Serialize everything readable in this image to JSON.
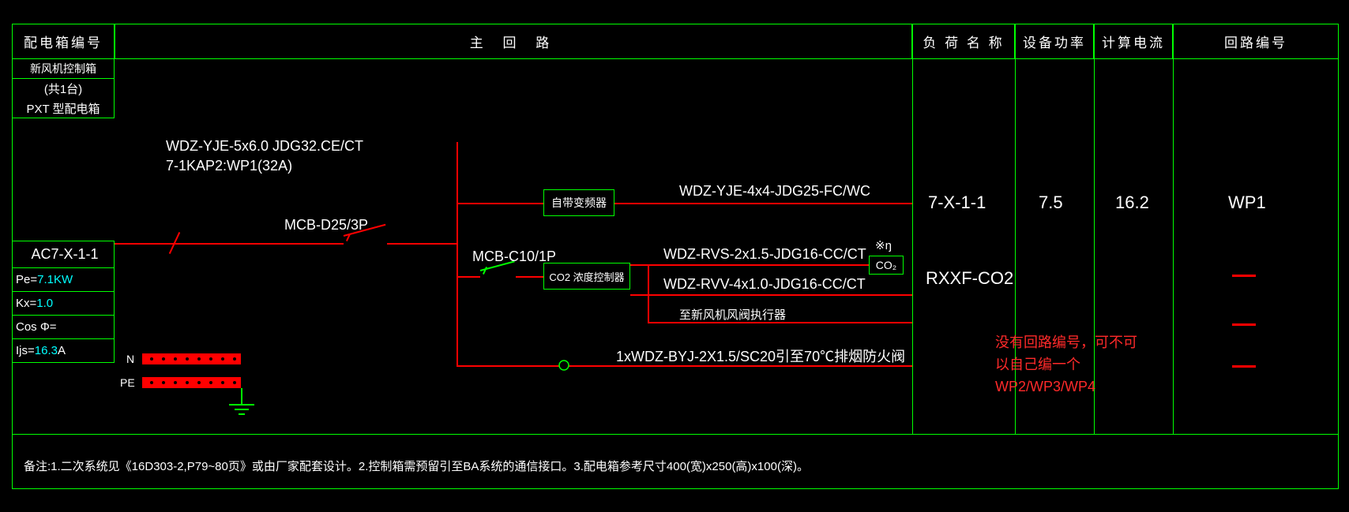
{
  "header": {
    "col1": "配电箱编号",
    "col_main": "主 回 路",
    "col_load": "负 荷 名 称",
    "col_power": "设备功率",
    "col_current": "计算电流",
    "col_loop": "回路编号"
  },
  "side": {
    "line1": "新风机控制箱",
    "line2": "(共1台)",
    "line3": "PXT 型配电箱",
    "panel_id": "AC7-X-1-1",
    "pe_label": "Pe=",
    "pe_val": "7.1KW",
    "kx_label": "Kx=",
    "kx_val": "1.0",
    "cos_label": "Cos Φ=",
    "ijs_label": "Ijs=",
    "ijs_val": "16.3",
    "ijs_unit": "A"
  },
  "busbars": {
    "n": "N",
    "pe": "PE"
  },
  "wires": {
    "incoming_top": "WDZ-YJE-5x6.0 JDG32.CE/CT",
    "incoming_bot": "7-1KAP2:WP1(32A)",
    "mcb_main": "MCB-D25/3P",
    "mcb_sub": "MCB-C10/1P",
    "inverter_box": "自带变频器",
    "co2_box": "CO2 浓度控制器",
    "cable1": "WDZ-YJE-4x4-JDG25-FC/WC",
    "cable2": "WDZ-RVS-2x1.5-JDG16-CC/CT",
    "cable3": "WDZ-RVV-4x1.0-JDG16-CC/CT",
    "note3": "至新风机风阀执行器",
    "cable4": "1xWDZ-BYJ-2X1.5/SC20引至70℃排烟防火阀",
    "sensor": "CO₂",
    "sensor_top": "※ŋ"
  },
  "rows": {
    "r1_load": "7-X-1-1",
    "r1_power": "7.5",
    "r1_current": "16.2",
    "r1_loop": "WP1",
    "r2_load": "RXXF-CO2"
  },
  "annotation": {
    "l1": "没有回路编号，可不可",
    "l2": "以自己编一个",
    "l3": "WP2/WP3/WP4"
  },
  "footer": "备注:1.二次系统见《16D303-2,P79~80页》或由厂家配套设计。2.控制箱需预留引至BA系统的通信接口。3.配电箱参考尺寸400(宽)x250(高)x100(深)。"
}
